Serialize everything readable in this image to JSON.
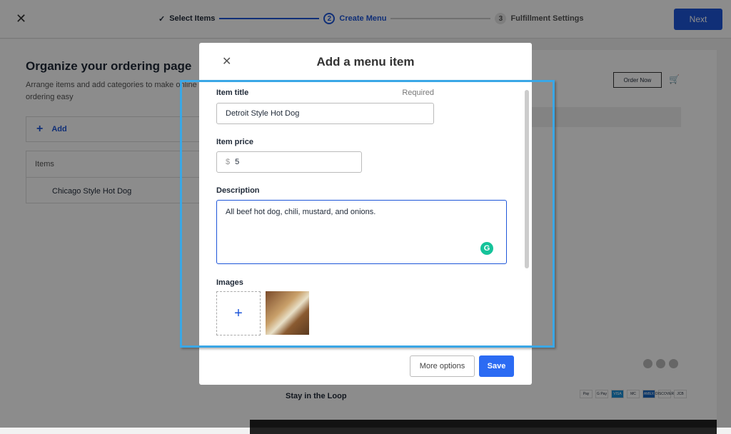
{
  "topbar": {
    "steps": [
      {
        "label": "Select Items",
        "state": "done"
      },
      {
        "label": "Create Menu",
        "num": "2",
        "state": "active"
      },
      {
        "label": "Fulfillment Settings",
        "num": "3",
        "state": "pending"
      }
    ],
    "next_label": "Next"
  },
  "left": {
    "title": "Organize your ordering page",
    "desc": "Arrange items and add categories to make online ordering easy",
    "add_label": "Add",
    "items_header": "Items",
    "items": [
      "Chicago Style Hot Dog"
    ]
  },
  "preview": {
    "order_now": "Order Now",
    "stay": "Stay in the Loop",
    "payments": [
      "Pay",
      "G Pay",
      "VISA",
      "MC",
      "AMEX",
      "DISCOVER",
      "JCB"
    ]
  },
  "modal": {
    "title": "Add a menu item",
    "item_title_label": "Item title",
    "required": "Required",
    "item_title_value": "Detroit Style Hot Dog",
    "price_label": "Item price",
    "currency": "$",
    "price_value": "5",
    "description_label": "Description",
    "description_value": "All beef hot dog, chili, mustard, and onions.",
    "images_label": "Images",
    "more_options": "More options",
    "save": "Save"
  },
  "colors": {
    "accent": "#1e56d9",
    "save": "#2b6bf3",
    "highlight": "#3aa7e6"
  }
}
